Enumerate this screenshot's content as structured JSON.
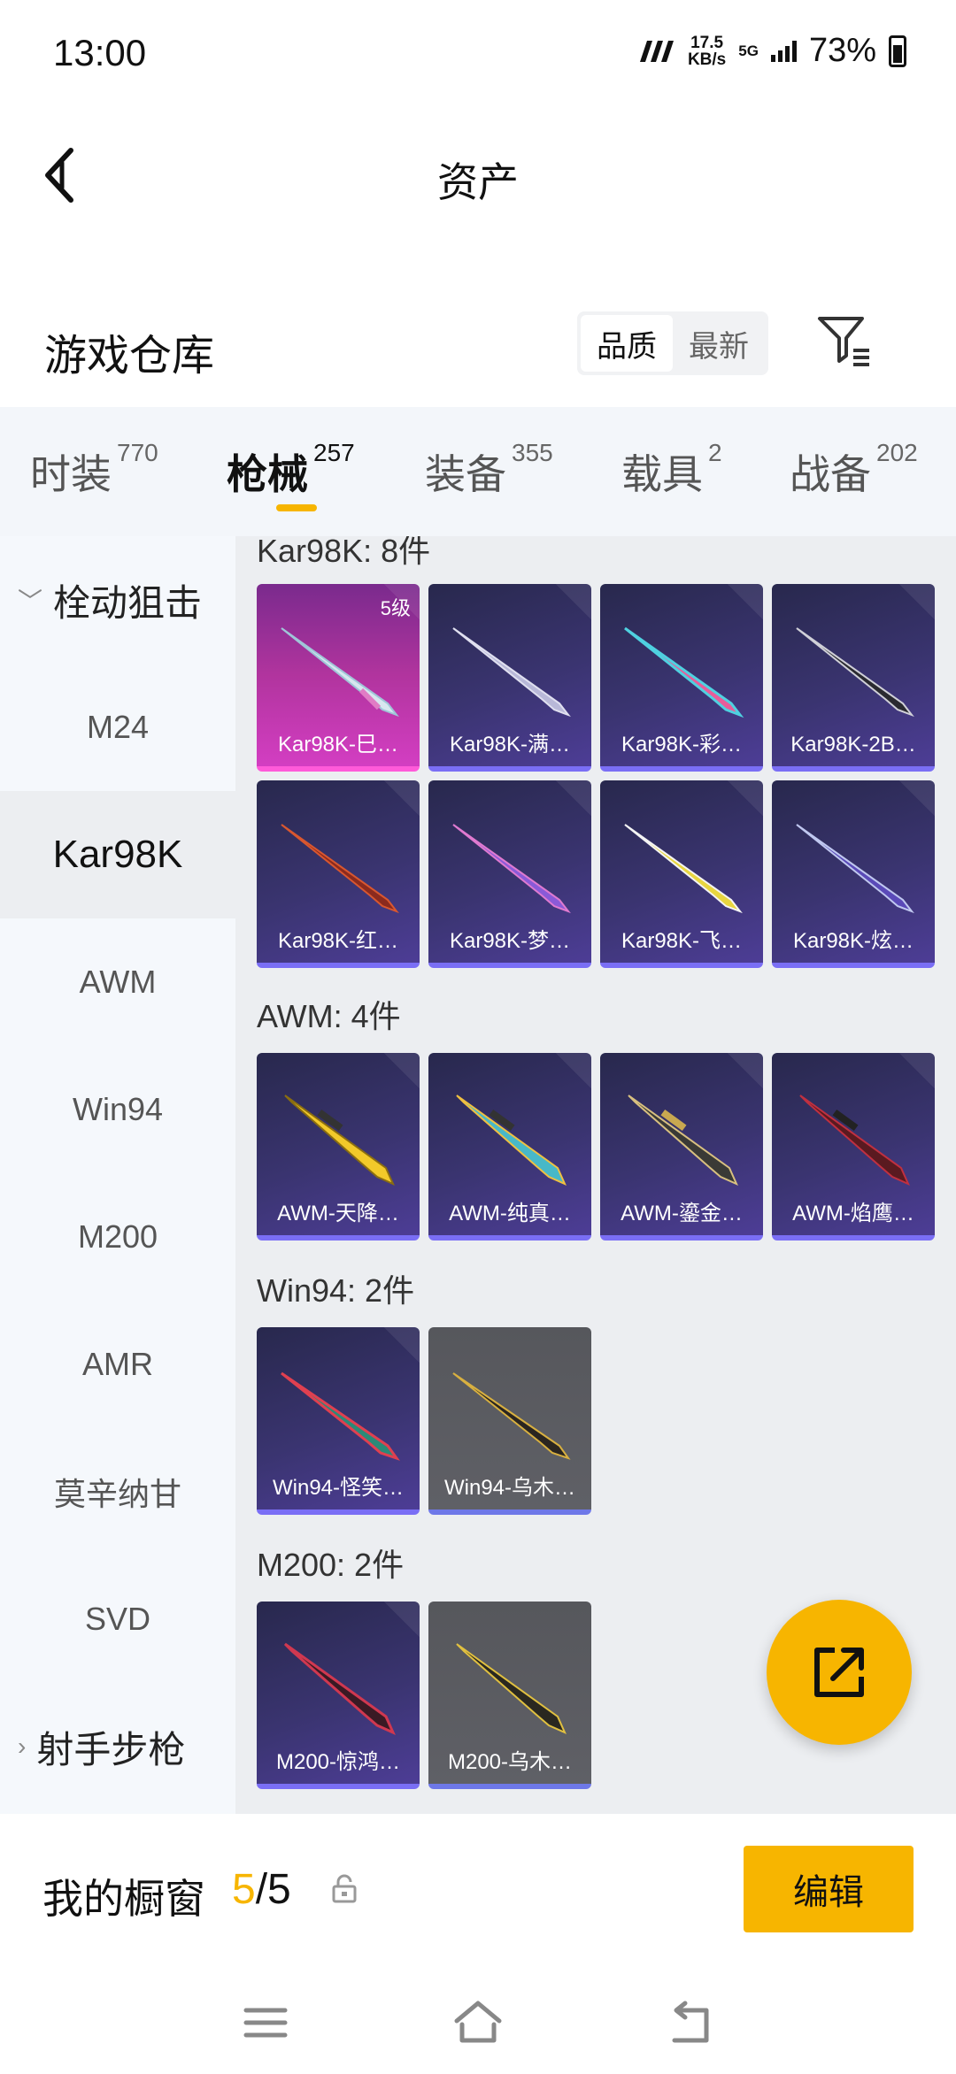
{
  "status": {
    "time": "13:00",
    "speed_value": "17.5",
    "speed_unit": "KB/s",
    "network": "5G",
    "battery": "73%"
  },
  "header": {
    "title": "资产"
  },
  "warehouse": {
    "title": "游戏仓库",
    "sort_options": [
      "品质",
      "最新"
    ],
    "sort_selected": "品质"
  },
  "tabs": [
    {
      "label": "时装",
      "count": "770"
    },
    {
      "label": "枪械",
      "count": "257"
    },
    {
      "label": "装备",
      "count": "355"
    },
    {
      "label": "载具",
      "count": "2"
    },
    {
      "label": "战备",
      "count": "202"
    }
  ],
  "sidebar": {
    "group1": "栓动狙击",
    "items": [
      "M24",
      "Kar98K",
      "AWM",
      "Win94",
      "M200",
      "AMR",
      "莫辛纳甘",
      "SVD"
    ],
    "group2": "射手步枪"
  },
  "sections": [
    {
      "title": "Kar98K: 8件",
      "items": [
        {
          "name": "Kar98K-巳…",
          "level": "5级"
        },
        {
          "name": "Kar98K-满…"
        },
        {
          "name": "Kar98K-彩…"
        },
        {
          "name": "Kar98K-2B…"
        },
        {
          "name": "Kar98K-红…"
        },
        {
          "name": "Kar98K-梦…"
        },
        {
          "name": "Kar98K-飞…"
        },
        {
          "name": "Kar98K-炫…"
        }
      ]
    },
    {
      "title": "AWM: 4件",
      "items": [
        {
          "name": "AWM-天降…"
        },
        {
          "name": "AWM-纯真…"
        },
        {
          "name": "AWM-鎏金…"
        },
        {
          "name": "AWM-焰鹰…"
        }
      ]
    },
    {
      "title": "Win94: 2件",
      "items": [
        {
          "name": "Win94-怪笑…"
        },
        {
          "name": "Win94-乌木…"
        }
      ]
    },
    {
      "title": "M200: 2件",
      "items": [
        {
          "name": "M200-惊鸿…"
        },
        {
          "name": "M200-乌木…"
        }
      ]
    }
  ],
  "showcase": {
    "title": "我的橱窗",
    "current": "5",
    "separator": "/",
    "total": "5",
    "edit_label": "编辑"
  },
  "colors": {
    "accent": "#f7b500",
    "card_purple": "#3a3470",
    "card_pink": "#d33ec2",
    "card_grey": "#5f6066"
  }
}
